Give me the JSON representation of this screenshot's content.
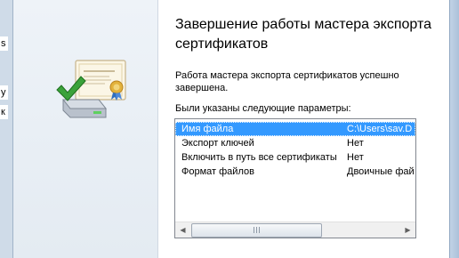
{
  "wizard": {
    "title": "Завершение работы мастера экспорта сертификатов",
    "status": "Работа мастера экспорта сертификатов успешно завершена.",
    "params_label": "Были указаны следующие параметры:"
  },
  "params": [
    {
      "name": "Имя файла",
      "value": "C:\\Users\\sav.D",
      "selected": true
    },
    {
      "name": "Экспорт ключей",
      "value": "Нет"
    },
    {
      "name": "Включить в путь все сертификаты",
      "value": "Нет"
    },
    {
      "name": "Формат файлов",
      "value": "Двоичные фай"
    }
  ],
  "background_fragments": [
    "s",
    "у",
    "к"
  ],
  "icons": {
    "wizard_art": "certificate-export-icon",
    "scroll_left": "arrow-left-icon",
    "scroll_right": "arrow-right-icon"
  },
  "colors": {
    "selection": "#3399ff",
    "check_green": "#3aa23a"
  }
}
